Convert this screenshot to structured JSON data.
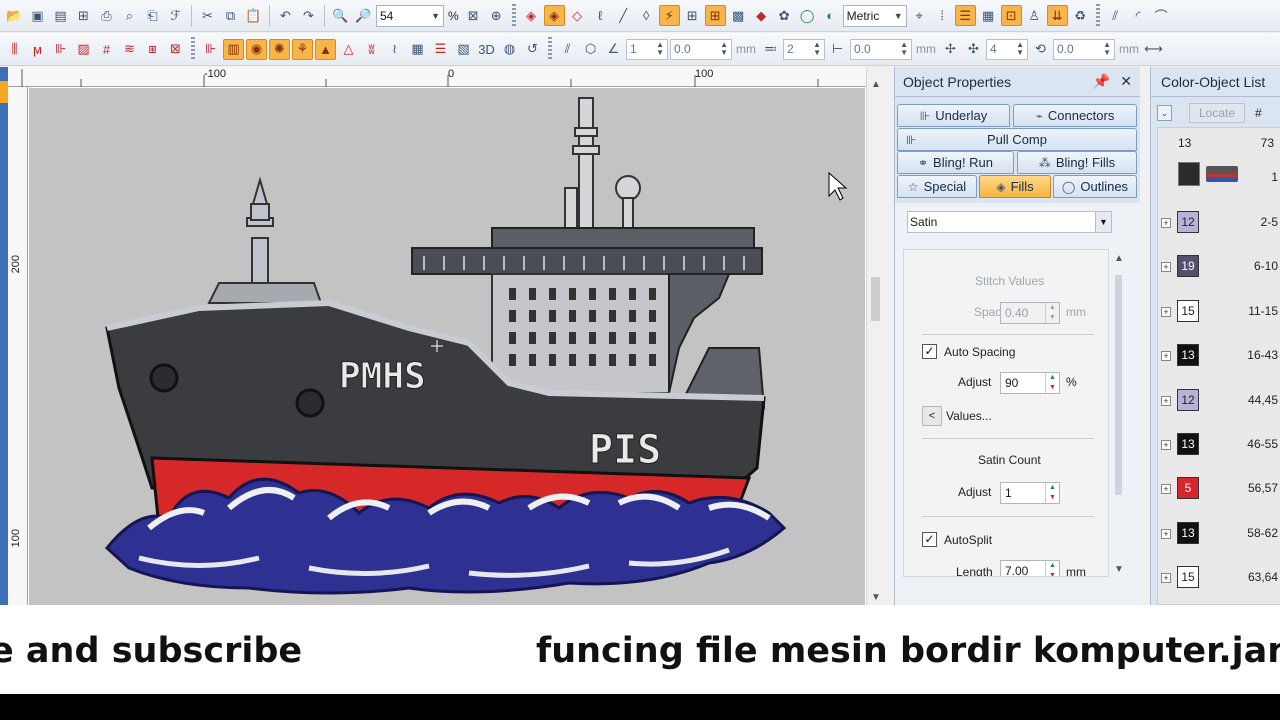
{
  "toolbar1": {
    "zoom_value": "54",
    "zoom_unit": "%",
    "units_select": "Metric"
  },
  "toolbar2": {
    "label_3d": "3D",
    "field_a": "1",
    "field_b": "0.0",
    "field_c": "2",
    "field_d": "0.0",
    "field_e": "4",
    "field_f": "0.0",
    "unit_mm": "mm"
  },
  "ruler": {
    "h_labels": [
      "-100",
      "0",
      "100"
    ],
    "v_labels": [
      "200",
      "100"
    ]
  },
  "design": {
    "bow_text": "PMHS",
    "hull_text": "PIS"
  },
  "object_properties": {
    "title": "Object Properties",
    "pin_icon": "pin-icon",
    "close_icon": "close-icon",
    "tabs": [
      {
        "label": "Underlay",
        "icon": "underlay-icon"
      },
      {
        "label": "Connectors",
        "icon": "connectors-icon"
      },
      {
        "label": "Pull Comp",
        "icon": "pull-comp-icon"
      },
      {
        "label": "Bling! Run",
        "icon": "bling-run-icon"
      },
      {
        "label": "Bling! Fills",
        "icon": "bling-fills-icon"
      },
      {
        "label": "Special",
        "icon": "star-icon"
      },
      {
        "label": "Fills",
        "icon": "fills-icon"
      },
      {
        "label": "Outlines",
        "icon": "outlines-icon"
      }
    ],
    "active_tab": "Fills",
    "fill_type": "Satin",
    "stitch_values_heading": "Stitch Values",
    "spacing_label": "Spacing",
    "spacing_value": "0.40",
    "spacing_unit": "mm",
    "auto_spacing_label": "Auto Spacing",
    "auto_spacing_checked": true,
    "adjust_label": "Adjust",
    "adjust_value": "90",
    "adjust_unit": "%",
    "values_button": "Values...",
    "values_arrow": "<",
    "satin_count_heading": "Satin Count",
    "satin_adjust_label": "Adjust",
    "satin_adjust_value": "1",
    "autosplit_label": "AutoSplit",
    "autosplit_checked": true,
    "length_label": "Length",
    "length_value": "7.00",
    "length_unit": "mm"
  },
  "color_object_list": {
    "title": "Color-Object List",
    "locate_button": "Locate",
    "hash_label": "#",
    "header_left": "13",
    "header_right": "73",
    "thumb_row_index": "1",
    "rows": [
      {
        "number": "12",
        "range": "2-5",
        "color": "#b8b2d9",
        "text_color": "#222"
      },
      {
        "number": "19",
        "range": "6-10",
        "color": "#55506e",
        "text_color": "#fff"
      },
      {
        "number": "15",
        "range": "11-15",
        "color": "#ffffff",
        "text_color": "#222"
      },
      {
        "number": "13",
        "range": "16-43",
        "color": "#111111",
        "text_color": "#fff"
      },
      {
        "number": "12",
        "range": "44,45",
        "color": "#b8b2d9",
        "text_color": "#222"
      },
      {
        "number": "13",
        "range": "46-55",
        "color": "#111111",
        "text_color": "#fff"
      },
      {
        "number": "5",
        "range": "56,57",
        "color": "#d7262b",
        "text_color": "#fff"
      },
      {
        "number": "13",
        "range": "58-62",
        "color": "#111111",
        "text_color": "#fff"
      },
      {
        "number": "15",
        "range": "63,64",
        "color": "#ffffff",
        "text_color": "#222"
      }
    ]
  },
  "caption": {
    "left": "e and subscribe",
    "right": "funcing file mesin bordir komputer.jang"
  }
}
